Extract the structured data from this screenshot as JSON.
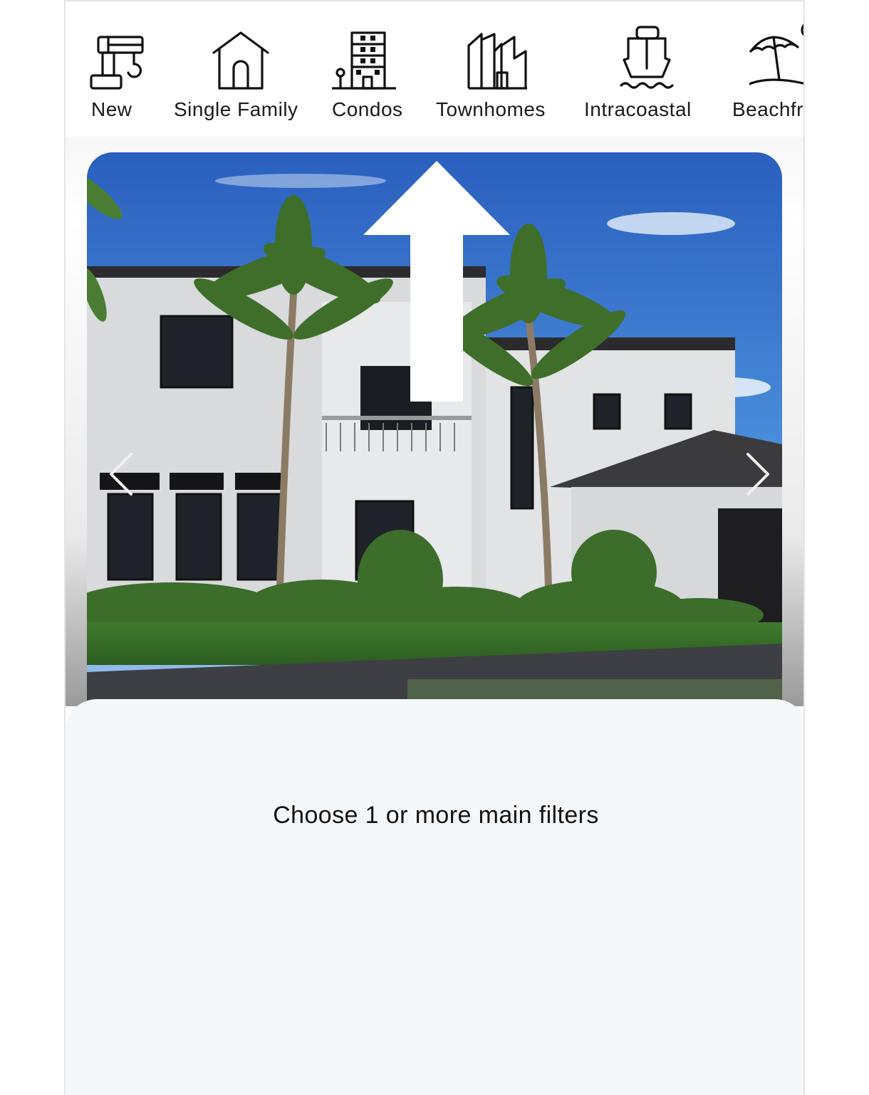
{
  "filters": [
    {
      "label": "New",
      "icon": "crane-icon"
    },
    {
      "label": "Single Family",
      "icon": "house-icon"
    },
    {
      "label": "Condos",
      "icon": "building-icon"
    },
    {
      "label": "Townhomes",
      "icon": "townhouse-icon"
    },
    {
      "label": "Intracoastal",
      "icon": "boat-icon"
    },
    {
      "label": "Beachfr",
      "icon": "beach-umbrella-icon"
    }
  ],
  "hero": {
    "image": "modern-two-story-house-with-palm-trees-photo",
    "prev_icon": "chevron-left-icon",
    "next_icon": "chevron-right-icon",
    "overlay_icon": "arrow-up-icon"
  },
  "panel": {
    "hint": "Choose 1 or more main filters"
  },
  "colors": {
    "panel_bg": "#f5f8fa",
    "icon_stroke": "#111111",
    "sky": "#3f86d8"
  }
}
